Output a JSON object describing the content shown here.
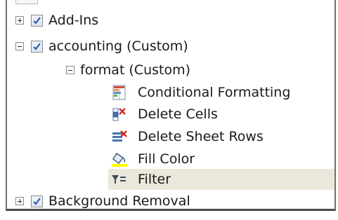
{
  "tree": {
    "items": [
      {
        "type": "group",
        "label": "Add-Ins",
        "expanded": false,
        "checked": true
      },
      {
        "type": "tab",
        "label": "accounting (Custom)",
        "expanded": true,
        "checked": true
      },
      {
        "type": "subgroup",
        "label": "format (Custom)",
        "expanded": true
      },
      {
        "type": "command",
        "label": "Conditional Formatting",
        "icon": "conditional-formatting-icon"
      },
      {
        "type": "command",
        "label": "Delete Cells",
        "icon": "delete-cells-icon"
      },
      {
        "type": "command",
        "label": "Delete Sheet Rows",
        "icon": "delete-sheet-rows-icon"
      },
      {
        "type": "command",
        "label": "Fill Color",
        "icon": "fill-color-icon"
      },
      {
        "type": "command",
        "label": "Filter",
        "icon": "filter-icon",
        "selected": true
      },
      {
        "type": "group",
        "label": "Background Removal",
        "expanded": false,
        "checked": true
      }
    ]
  },
  "colors": {
    "selection_highlight": "#ebe8db",
    "checkbox_check": "#2b5ea8",
    "fill_color_bar": "#ffff00"
  }
}
